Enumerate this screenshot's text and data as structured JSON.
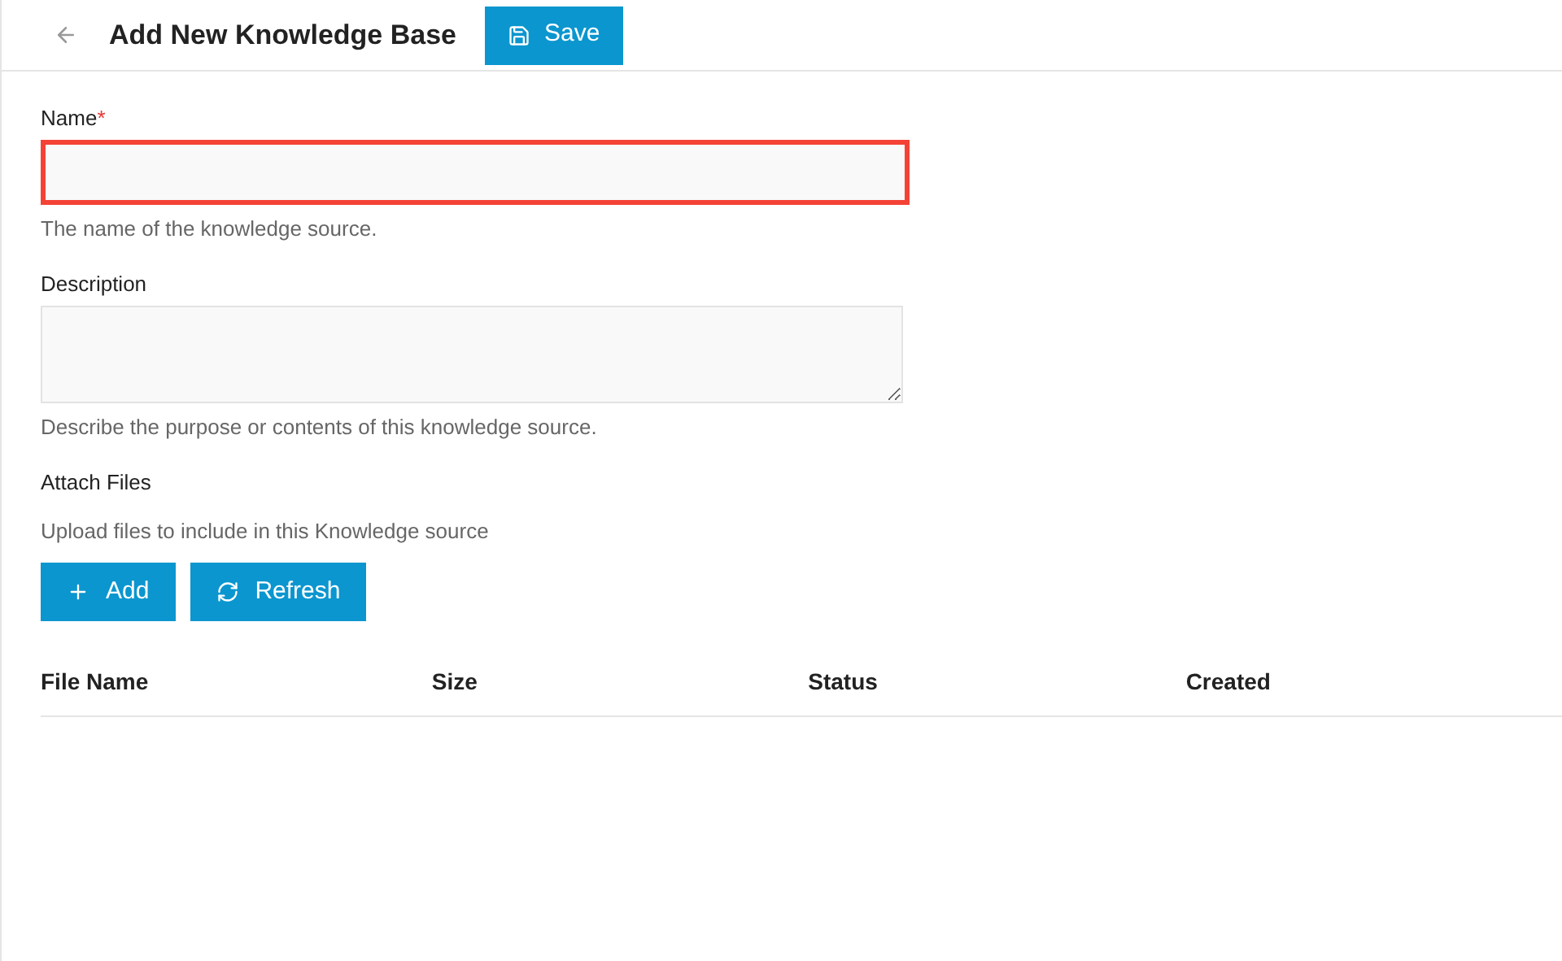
{
  "header": {
    "title": "Add New Knowledge Base",
    "save_button": "Save"
  },
  "fields": [
    {
      "kind": "input",
      "label": "Name",
      "required_mark": "*",
      "invalid": true,
      "help": "The name of the knowledge source."
    },
    {
      "kind": "textarea",
      "label": "Description",
      "invalid": false,
      "help": "Describe the purpose or contents of this knowledge source."
    }
  ],
  "attach": {
    "title": "Attach Files",
    "help": "Upload files to include in this Knowledge source",
    "buttons": [
      {
        "kind": "add",
        "label": "Add"
      },
      {
        "kind": "refresh",
        "label": "Refresh"
      }
    ]
  },
  "table": {
    "columns": [
      "File Name",
      "Size",
      "Status",
      "Created"
    ]
  }
}
